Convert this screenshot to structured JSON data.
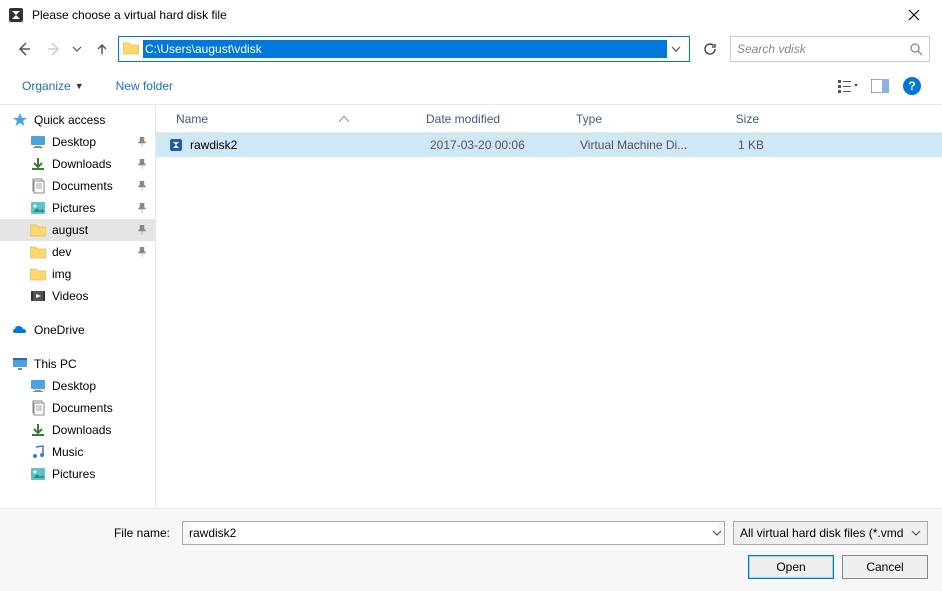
{
  "title": "Please choose a virtual hard disk file",
  "address_path": "C:\\Users\\august\\vdisk",
  "search_placeholder": "Search vdisk",
  "toolbar": {
    "organize_label": "Organize",
    "newfolder_label": "New folder"
  },
  "columns": {
    "name": "Name",
    "date": "Date modified",
    "type": "Type",
    "size": "Size"
  },
  "sidebar": {
    "quick_access": "Quick access",
    "quick_items": [
      {
        "label": "Desktop",
        "icon": "desktop",
        "pinned": true
      },
      {
        "label": "Downloads",
        "icon": "downloads",
        "pinned": true
      },
      {
        "label": "Documents",
        "icon": "documents",
        "pinned": true
      },
      {
        "label": "Pictures",
        "icon": "pictures",
        "pinned": true
      },
      {
        "label": "august",
        "icon": "folder",
        "pinned": true,
        "selected": true
      },
      {
        "label": "dev",
        "icon": "folder",
        "pinned": true
      },
      {
        "label": "img",
        "icon": "folder",
        "pinned": false
      },
      {
        "label": "Videos",
        "icon": "videos",
        "pinned": false
      }
    ],
    "onedrive": "OneDrive",
    "this_pc": "This PC",
    "pc_items": [
      {
        "label": "Desktop",
        "icon": "desktop"
      },
      {
        "label": "Documents",
        "icon": "documents"
      },
      {
        "label": "Downloads",
        "icon": "downloads"
      },
      {
        "label": "Music",
        "icon": "music"
      },
      {
        "label": "Pictures",
        "icon": "pictures"
      }
    ]
  },
  "files": [
    {
      "name": "rawdisk2",
      "date": "2017-03-20 00:06",
      "type": "Virtual Machine Di...",
      "size": "1 KB",
      "selected": true
    }
  ],
  "footer": {
    "filename_label": "File name:",
    "filename_value": "rawdisk2",
    "filetype_label": "All virtual hard disk files (*.vmd",
    "open_label": "Open",
    "cancel_label": "Cancel"
  }
}
